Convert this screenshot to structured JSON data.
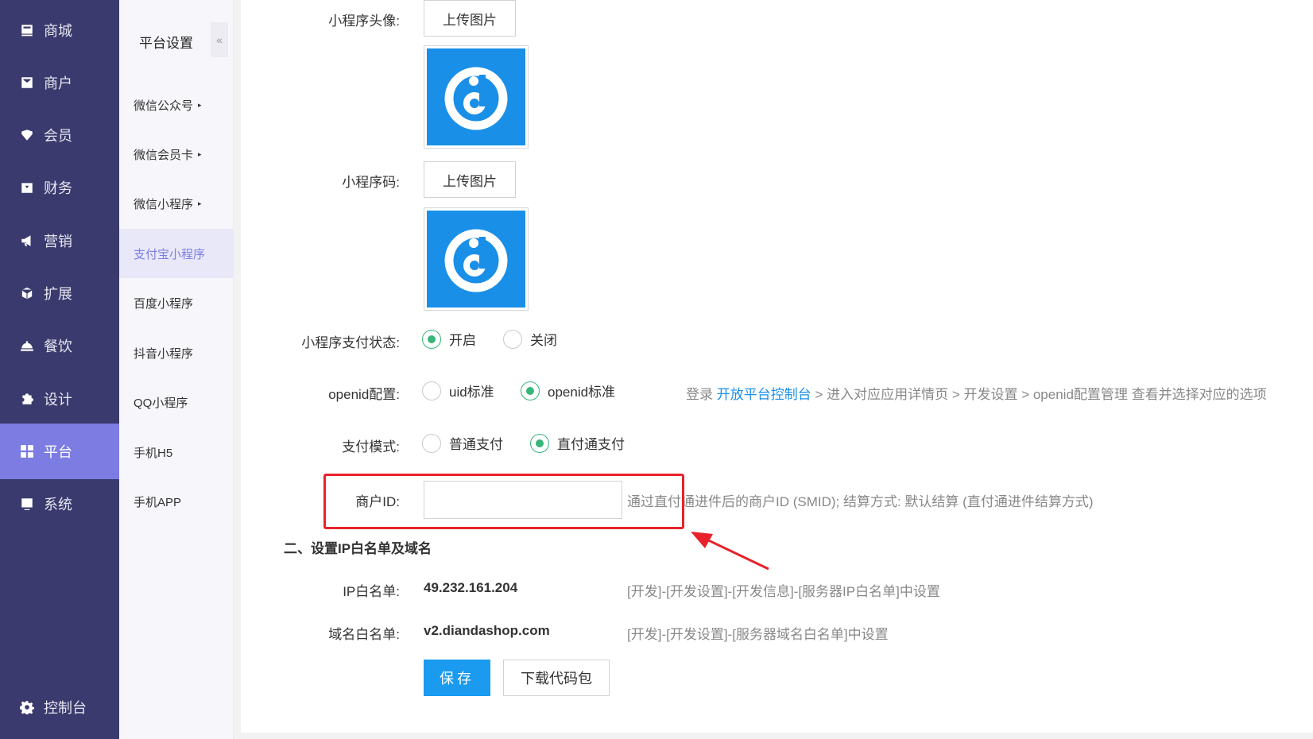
{
  "mainnav": {
    "items": [
      {
        "label": "商城",
        "icon": "shop-icon"
      },
      {
        "label": "商户",
        "icon": "merchant-icon"
      },
      {
        "label": "会员",
        "icon": "member-icon"
      },
      {
        "label": "财务",
        "icon": "finance-icon"
      },
      {
        "label": "营销",
        "icon": "megaphone-icon"
      },
      {
        "label": "扩展",
        "icon": "cube-icon"
      },
      {
        "label": "餐饮",
        "icon": "cloche-icon"
      },
      {
        "label": "设计",
        "icon": "puzzle-icon"
      },
      {
        "label": "平台",
        "icon": "grid-icon",
        "active": true
      },
      {
        "label": "系统",
        "icon": "system-icon"
      }
    ],
    "console": {
      "label": "控制台",
      "icon": "gear-icon"
    }
  },
  "subnav": {
    "title": "平台设置",
    "collapse": "«",
    "items": [
      {
        "label": "微信公众号",
        "caret": "▸"
      },
      {
        "label": "微信会员卡",
        "caret": "▸"
      },
      {
        "label": "微信小程序",
        "caret": "▸"
      },
      {
        "label": "支付宝小程序",
        "active": true
      },
      {
        "label": "百度小程序"
      },
      {
        "label": "抖音小程序"
      },
      {
        "label": "QQ小程序"
      },
      {
        "label": "手机H5"
      },
      {
        "label": "手机APP"
      }
    ]
  },
  "form": {
    "avatar_label": "小程序头像:",
    "avatar_upload": "上传图片",
    "qrcode_label": "小程序码:",
    "qrcode_upload": "上传图片",
    "pay_status_label": "小程序支付状态:",
    "pay_status_on": "开启",
    "pay_status_off": "关闭",
    "openid_label": "openid配置:",
    "openid_opt1": "uid标准",
    "openid_opt2": "openid标准",
    "openid_hint_prefix": "登录 ",
    "openid_hint_link": "开放平台控制台",
    "openid_hint_suffix": " > 进入对应应用详情页 > 开发设置 > openid配置管理 查看并选择对应的选项",
    "pay_mode_label": "支付模式:",
    "pay_mode_opt1": "普通支付",
    "pay_mode_opt2": "直付通支付",
    "merchant_id_label": "商户ID:",
    "merchant_id_value": "",
    "merchant_id_hint": "通过直付通进件后的商户ID (SMID);   结算方式: 默认结算 (直付通进件结算方式)",
    "section2_title": "二、设置IP白名单及域名",
    "ip_label": "IP白名单:",
    "ip_value": "49.232.161.204",
    "ip_hint": "[开发]-[开发设置]-[开发信息]-[服务器IP白名单]中设置",
    "domain_label": "域名白名单:",
    "domain_value": "v2.diandashop.com",
    "domain_hint": "[开发]-[开发设置]-[服务器域名白名单]中设置",
    "save_label": "保存",
    "download_label": "下载代码包"
  },
  "colors": {
    "sidebar": "#3a3a6e",
    "active": "#7c7ce3",
    "primary": "#1a9bf0",
    "radio": "#37b67a",
    "highlight": "#e8222a"
  }
}
